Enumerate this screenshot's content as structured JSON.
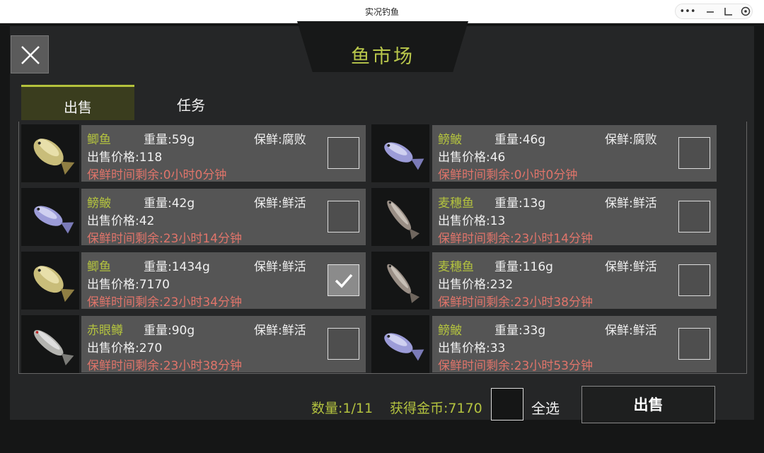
{
  "window": {
    "title": "实况钓鱼"
  },
  "header": {
    "title": "鱼市场"
  },
  "tabs": [
    {
      "label": "出售",
      "active": true
    },
    {
      "label": "任务",
      "active": false
    }
  ],
  "items": [
    {
      "name": "鲫鱼",
      "weight": "重量:59g",
      "freshness": "保鲜:腐败",
      "price": "出售价格:118",
      "remaining": "保鲜时间剩余:0小时0分钟",
      "checked": false,
      "fish_icon": "crucian-carp-icon"
    },
    {
      "name": "鳑鲏",
      "weight": "重量:46g",
      "freshness": "保鲜:腐败",
      "price": "出售价格:46",
      "remaining": "保鲜时间剩余:0小时0分钟",
      "checked": false,
      "fish_icon": "bitterling-icon"
    },
    {
      "name": "鳑鲏",
      "weight": "重量:42g",
      "freshness": "保鲜:鲜活",
      "price": "出售价格:42",
      "remaining": "保鲜时间剩余:23小时14分钟",
      "checked": false,
      "fish_icon": "bitterling-icon"
    },
    {
      "name": "麦穗鱼",
      "weight": "重量:13g",
      "freshness": "保鲜:鲜活",
      "price": "出售价格:13",
      "remaining": "保鲜时间剩余:23小时14分钟",
      "checked": false,
      "fish_icon": "stone-moroko-icon"
    },
    {
      "name": "鲫鱼",
      "weight": "重量:1434g",
      "freshness": "保鲜:鲜活",
      "price": "出售价格:7170",
      "remaining": "保鲜时间剩余:23小时34分钟",
      "checked": true,
      "fish_icon": "crucian-carp-icon"
    },
    {
      "name": "麦穗鱼",
      "weight": "重量:116g",
      "freshness": "保鲜:鲜活",
      "price": "出售价格:232",
      "remaining": "保鲜时间剩余:23小时38分钟",
      "checked": false,
      "fish_icon": "stone-moroko-icon"
    },
    {
      "name": "赤眼鳟",
      "weight": "重量:90g",
      "freshness": "保鲜:鲜活",
      "price": "出售价格:270",
      "remaining": "保鲜时间剩余:23小时38分钟",
      "checked": false,
      "fish_icon": "barbel-chub-icon"
    },
    {
      "name": "鳑鲏",
      "weight": "重量:33g",
      "freshness": "保鲜:鲜活",
      "price": "出售价格:33",
      "remaining": "保鲜时间剩余:23小时53分钟",
      "checked": false,
      "fish_icon": "bitterling-icon"
    }
  ],
  "footer": {
    "count": "数量:1/11",
    "gold": "获得金币:7170",
    "select_all_label": "全选",
    "sell_button": "出售"
  },
  "colors": {
    "accent": "#b3c23f",
    "warning": "#e0746a",
    "card": "#555555"
  }
}
